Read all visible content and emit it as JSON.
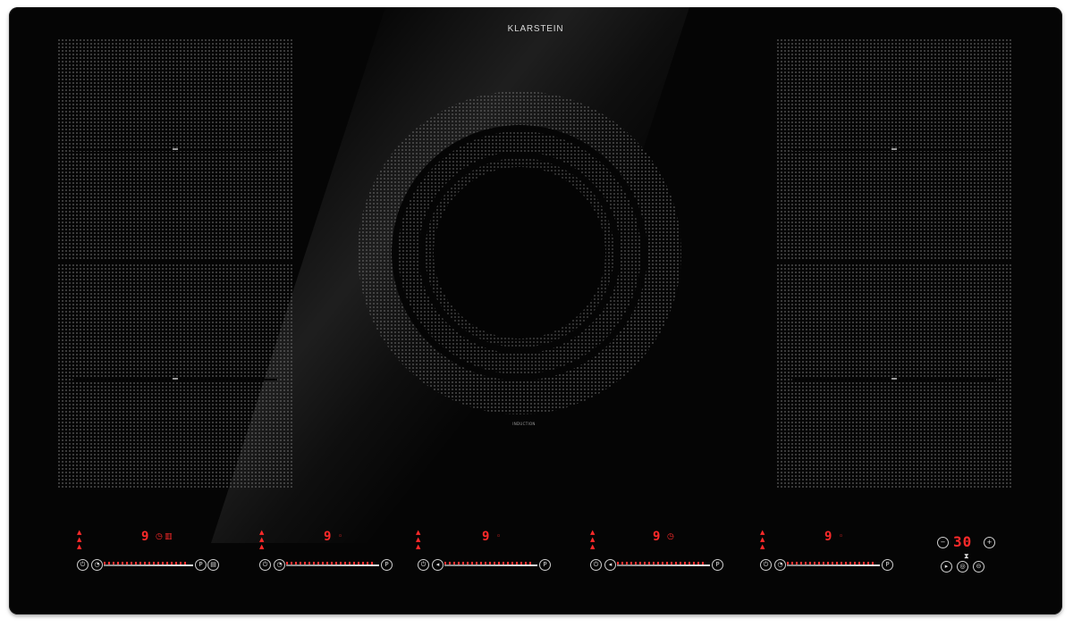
{
  "brand": {
    "name": "KLARSTEIN"
  },
  "center_zone": {
    "label": "INDUCTION"
  },
  "colors": {
    "glass": "#050505",
    "display_red": "#ff2a2a",
    "dot_grid": "#666666"
  },
  "panels": [
    {
      "level": "9",
      "icons": [
        "timer-icon",
        "boost-icon"
      ]
    },
    {
      "level": "9",
      "icons": [
        "timer-icon"
      ]
    },
    {
      "level": "9",
      "icons": [
        "timer-icon"
      ]
    },
    {
      "level": "9",
      "icons": [
        "timer-icon"
      ]
    },
    {
      "level": "9",
      "icons": [
        "timer-icon"
      ]
    }
  ],
  "timer": {
    "value": "30",
    "minus": "−",
    "plus": "+"
  },
  "buttons": {
    "power_boost": "P"
  }
}
